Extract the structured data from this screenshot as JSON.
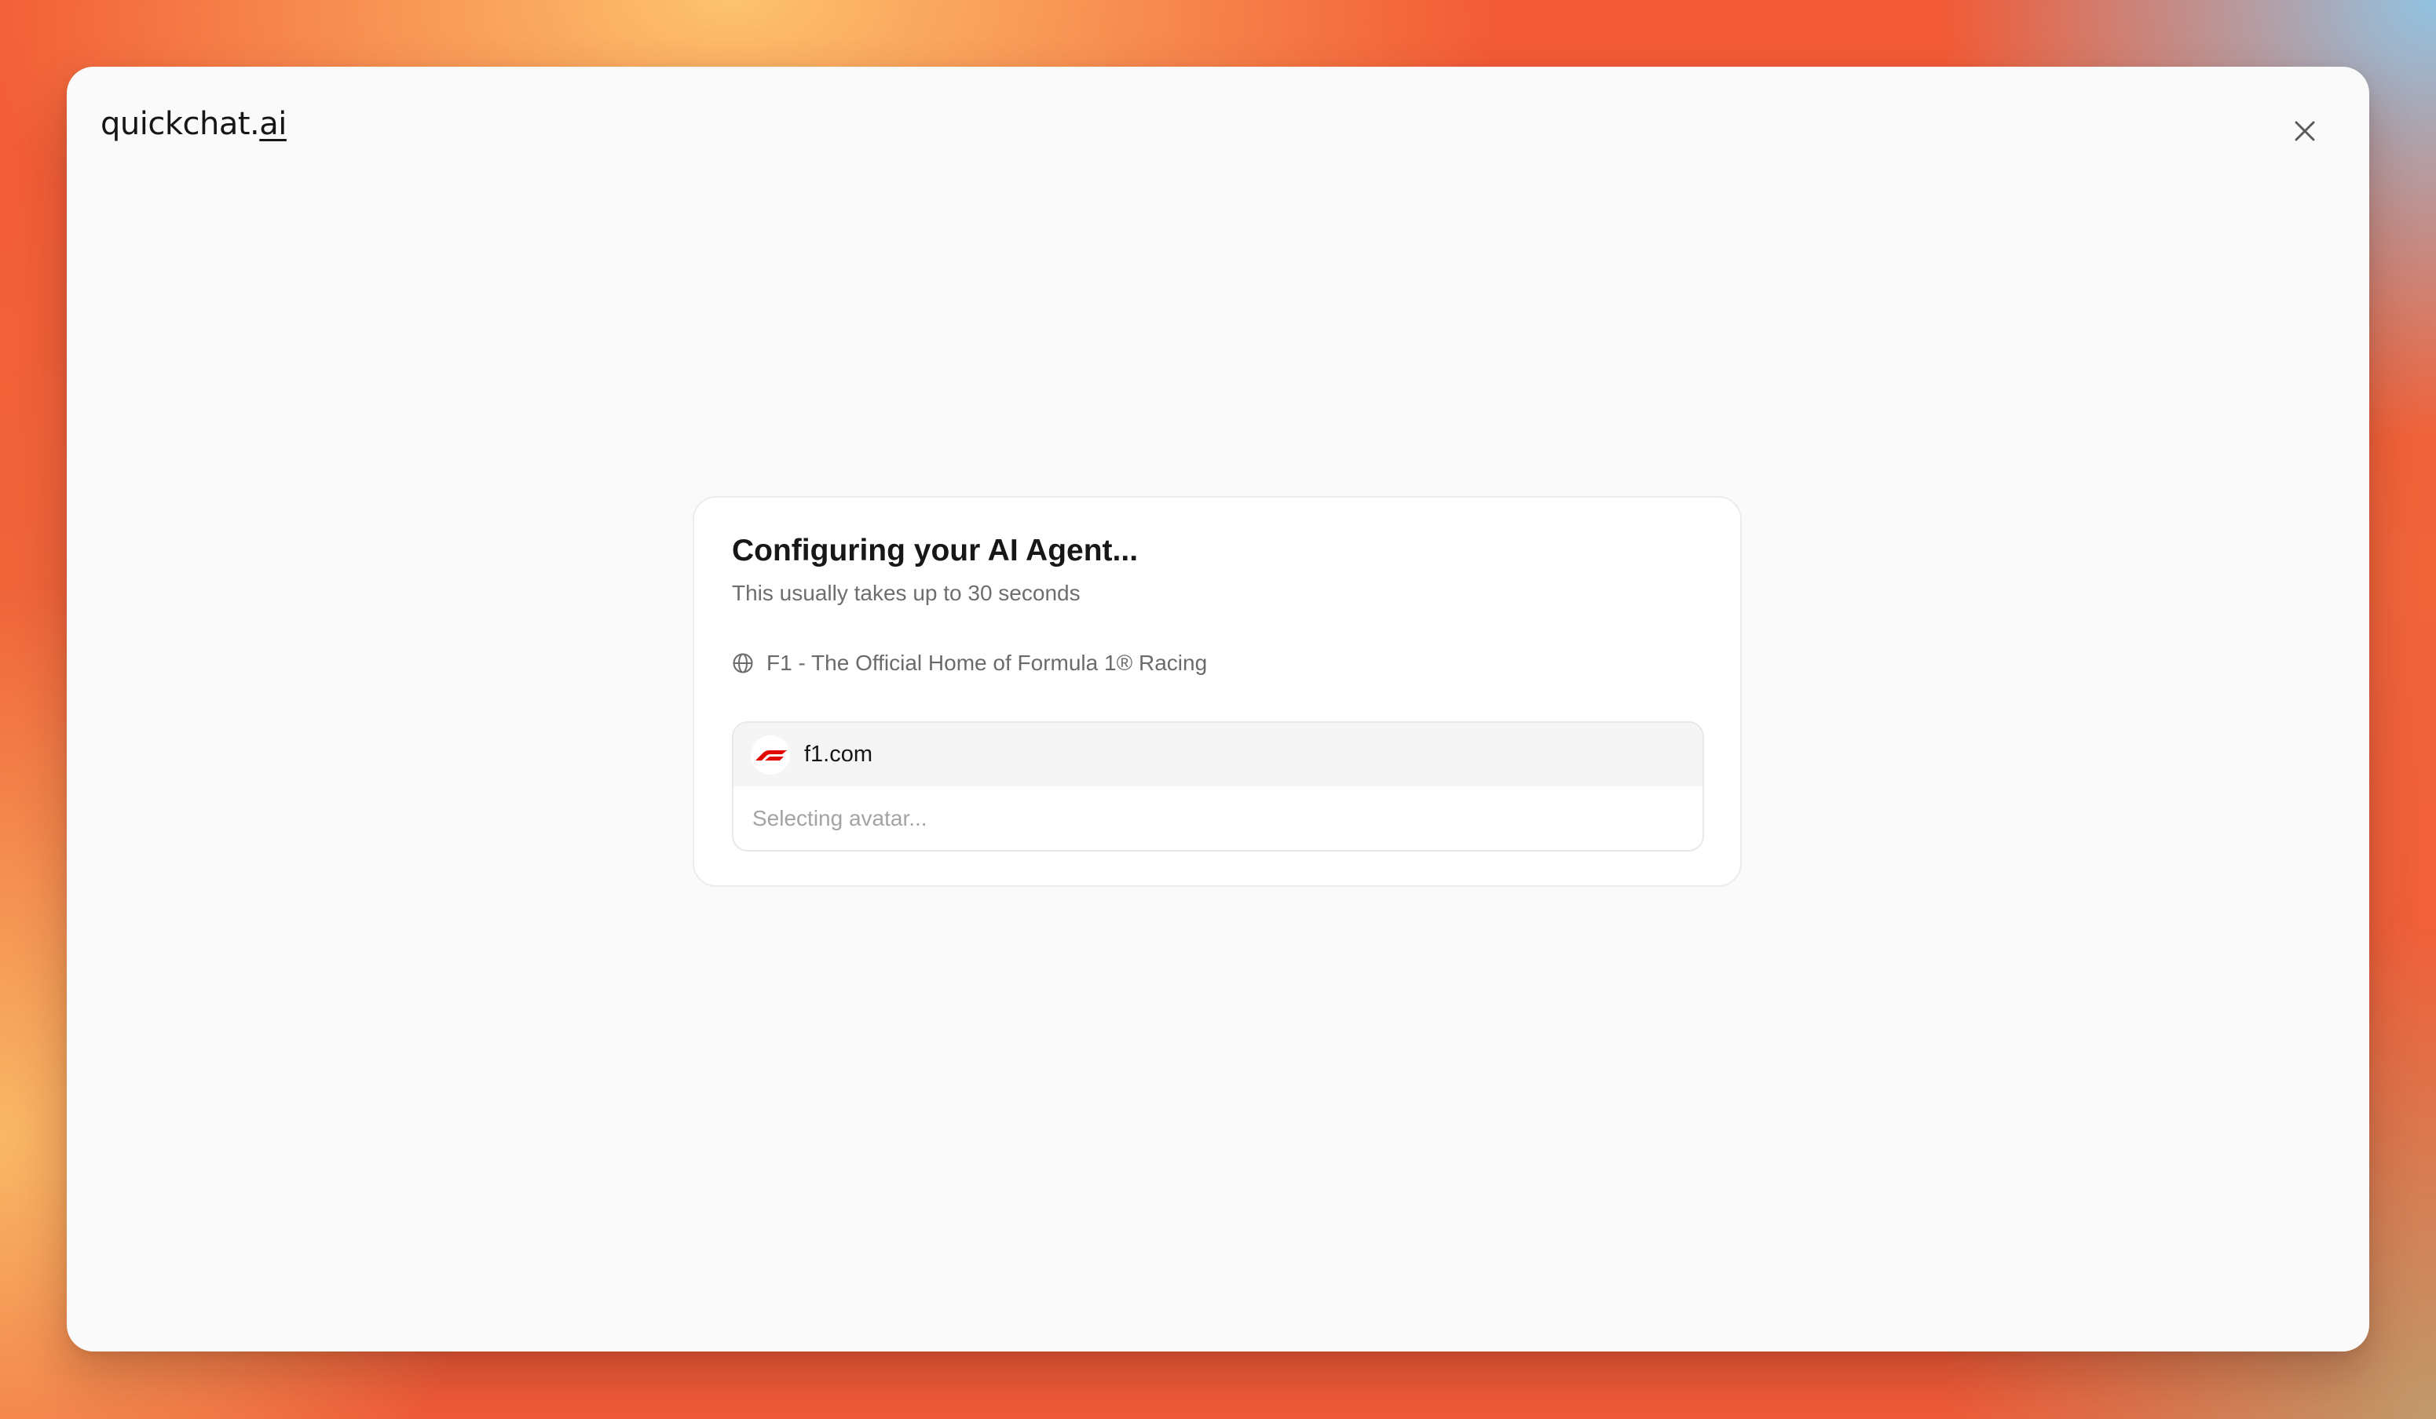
{
  "app": {
    "brand_name": "quickchat.",
    "brand_tld": "ai"
  },
  "window": {
    "close_icon": "close-icon"
  },
  "card": {
    "title": "Configuring your AI Agent...",
    "subtitle": "This usually takes up to 30 seconds",
    "site_icon": "globe-icon",
    "site_title": "F1 - The Official Home of Formula 1® Racing",
    "domain": {
      "favicon": "f1-logo-icon",
      "name": "f1.com",
      "status": "Selecting avatar..."
    }
  },
  "colors": {
    "accent_red": "#e10600",
    "text_primary": "#171717",
    "text_secondary": "#6e6e6e",
    "text_muted": "#a3a3a3"
  }
}
